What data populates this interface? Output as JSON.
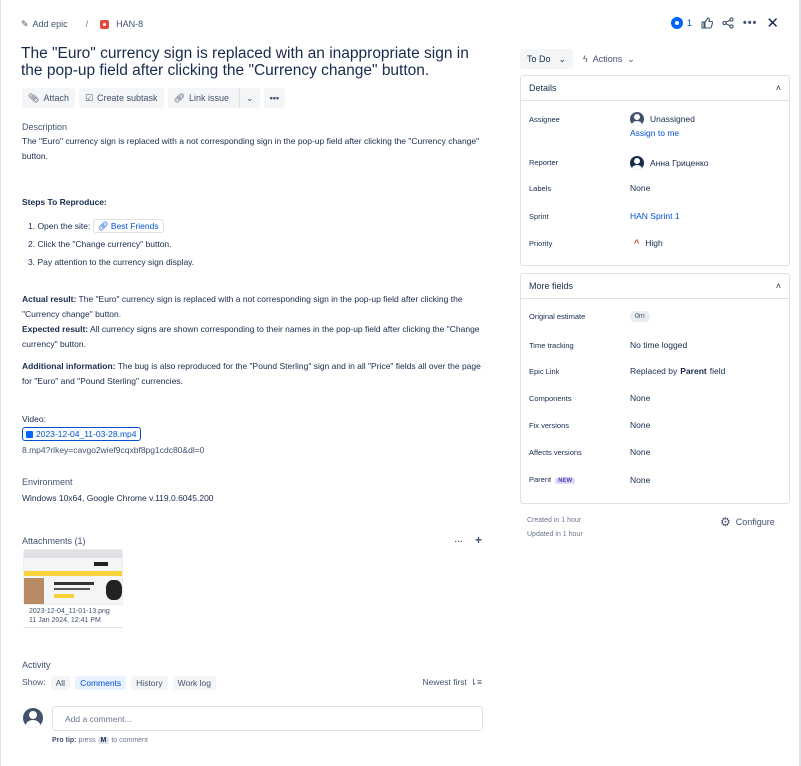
{
  "breadcrumb": {
    "add_epic": "Add epic",
    "separator": "/",
    "issue_key": "HAN-8"
  },
  "top_actions": {
    "watch_count": "1"
  },
  "issue": {
    "title": "The \"Euro\" currency sign is replaced with an inappropriate sign in the pop-up field after clicking the \"Currency change\" button."
  },
  "toolbar": {
    "attach": "Attach",
    "create_subtask": "Create subtask",
    "link_issue": "Link issue"
  },
  "description": {
    "heading": "Description",
    "text": "The \"Euro\" currency sign is replaced with a not corresponding sign in the pop-up field after clicking the \"Currency change\" button.",
    "steps_heading": "Steps To Reproduce:",
    "step1_prefix": "1. Open the site:",
    "step1_link": "Best Friends",
    "step2": "2. Click the \"Change currency\" button.",
    "step3": "3. Pay attention to the currency sign display.",
    "actual_label": "Actual result:",
    "actual_text": " The \"Euro\" currency sign is replaced with a not corresponding sign in the pop-up field after clicking the \"Currency change\" button.",
    "expected_label": "Expected result:",
    "expected_text": " All currency signs are shown corresponding to their names in the pop-up field after clicking the \"Change currency\" button.",
    "additional_label": "Additional information:",
    "additional_text": " The bug is also reproduced for the \"Pound Sterling\" sign and in all \"Price\" fields all over the page for \"Euro\" and \"Pound Sterling\" currencies.",
    "video_label": "Video:",
    "video_file": "2023-12-04_11-03-28.mp4",
    "video_tail": "8.mp4?rlkey=cavgo2wief9cqxbf8pg1cdc80&dl=0"
  },
  "environment": {
    "heading": "Environment",
    "text": "Windows 10x64, Google Chrome v.119.0.6045.200"
  },
  "attachments": {
    "heading": "Attachments (1)",
    "file_name": "2023-12-04_11-01-13.png",
    "file_date": "11 Jan 2024, 12:41 PM"
  },
  "activity": {
    "heading": "Activity",
    "show_label": "Show:",
    "filters": [
      "All",
      "Comments",
      "History",
      "Work log"
    ],
    "sort_label": "Newest first",
    "comment_placeholder": "Add a comment...",
    "protip_label": "Pro tip:",
    "protip_pre": "press",
    "protip_key": "M",
    "protip_post": "to comment"
  },
  "status": {
    "label": "To Do",
    "actions": "Actions"
  },
  "details": {
    "heading": "Details",
    "fields": {
      "assignee_key": "Assignee",
      "assignee_value": "Unassigned",
      "assign_to_me": "Assign to me",
      "reporter_key": "Reporter",
      "reporter_value": "Анна Гриценко",
      "labels_key": "Labels",
      "labels_value": "None",
      "sprint_key": "Sprint",
      "sprint_value": "HAN Sprint 1",
      "priority_key": "Priority",
      "priority_value": "High"
    }
  },
  "more_fields": {
    "heading": "More fields",
    "fields": {
      "estimate_key": "Original estimate",
      "estimate_value": "0m",
      "time_key": "Time tracking",
      "time_value": "No time logged",
      "epic_key": "Epic Link",
      "epic_value_pre": "Replaced by",
      "epic_value_bold": "Parent",
      "epic_value_post": "field",
      "components_key": "Components",
      "components_value": "None",
      "fix_key": "Fix versions",
      "fix_value": "None",
      "affects_key": "Affects versions",
      "affects_value": "None",
      "parent_key": "Parent",
      "parent_badge": "NEW",
      "parent_value": "None"
    }
  },
  "footer_meta": {
    "created": "Created in 1 hour",
    "updated": "Updated in 1 hour",
    "configure": "Configure"
  },
  "colors": {
    "accent": "#0052cc",
    "bug": "#e5493a",
    "priority_high": "#de350b"
  }
}
